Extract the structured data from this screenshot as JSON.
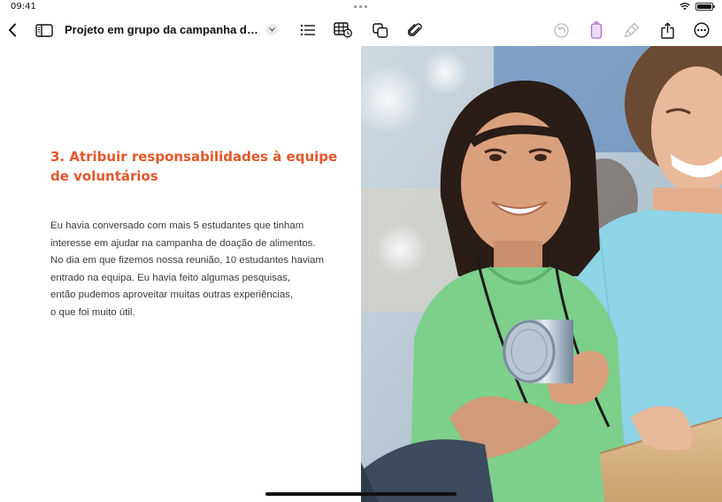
{
  "status_bar": {
    "time": "09:41"
  },
  "toolbar": {
    "document_title": "Projeto em grupo da campanha de doa...",
    "icons": {
      "back": "chevron-left-icon",
      "sidebar": "sidebar-icon",
      "title_menu": "chevron-down-icon",
      "list": "list-icon",
      "table": "table-icon",
      "shapes": "shapes-icon",
      "attachment": "paperclip-icon",
      "undo": "undo-icon",
      "highlighter": "highlighter-icon",
      "pen": "pen-icon",
      "share": "share-icon",
      "more": "ellipsis-circle-icon"
    },
    "highlighter_color": "#b06ad4"
  },
  "document": {
    "heading_lines": [
      "3. Atribuir responsabilidades à equipe",
      "de voluntários"
    ],
    "body_lines": [
      "Eu havia conversado com mais 5 estudantes que tinham",
      "interesse em ajudar na campanha de doação de alimentos.",
      "No dia em que fizemos nossa reunião, 10 estudantes haviam",
      "entrado na equipa. Eu havia feito algumas pesquisas,",
      "então pudemos aproveitar muitas outras experiências,",
      "o que foi muito útil."
    ],
    "heading_color": "#e2572b"
  }
}
